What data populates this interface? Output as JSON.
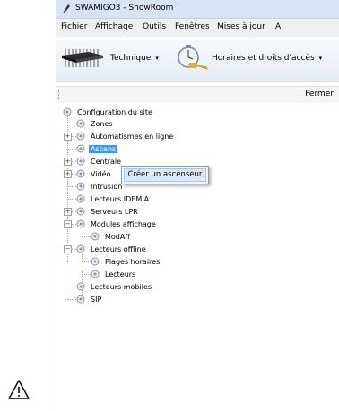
{
  "window": {
    "title": "SWAMIGO3 - ShowRoom"
  },
  "menu": [
    "Fichier",
    "Affichage",
    "Outils",
    "Fenêtres",
    "Mises à jour",
    "A"
  ],
  "toolbar": {
    "technique_label": "Technique",
    "horaires_label": "Horaires et droits d'accès",
    "dropdown_glyph": "▾"
  },
  "panel": {
    "close_label": "Fermer"
  },
  "tree": {
    "root": "Configuration du site",
    "items": [
      {
        "label": "Zones",
        "expandable": false
      },
      {
        "label": "Automatismes en ligne",
        "expandable": true,
        "state": "+"
      },
      {
        "label": "Ascenseurs",
        "expandable": false,
        "selected": true,
        "visible_text": "Ascens"
      },
      {
        "label": "Centrales",
        "expandable": true,
        "state": "+",
        "visible_text": "Centrale"
      },
      {
        "label": "Vidéo",
        "expandable": true,
        "state": "+"
      },
      {
        "label": "Intrusion",
        "expandable": false
      },
      {
        "label": "Lecteurs IDEMIA",
        "expandable": false
      },
      {
        "label": "Serveurs LPR",
        "expandable": true,
        "state": "+"
      },
      {
        "label": "Modules affichage",
        "expandable": true,
        "state": "−",
        "children": [
          "ModAff"
        ]
      },
      {
        "label": "Lecteurs offline",
        "expandable": true,
        "state": "−",
        "children": [
          "Plages horaires",
          "Lecteurs"
        ]
      },
      {
        "label": "Lecteurs mobiles",
        "expandable": false
      },
      {
        "label": "SIP",
        "expandable": false
      }
    ]
  },
  "context_menu": {
    "items": [
      "Créer un ascenseur"
    ]
  },
  "colors": {
    "selection": "#3399ff",
    "titlebar": "#d6e4f5",
    "warning": "#000000"
  },
  "icons": [
    "pencil-app-icon",
    "circuit-chip-icon",
    "stopwatch-key-icon",
    "gear-node-icon",
    "warning-triangle-icon"
  ]
}
